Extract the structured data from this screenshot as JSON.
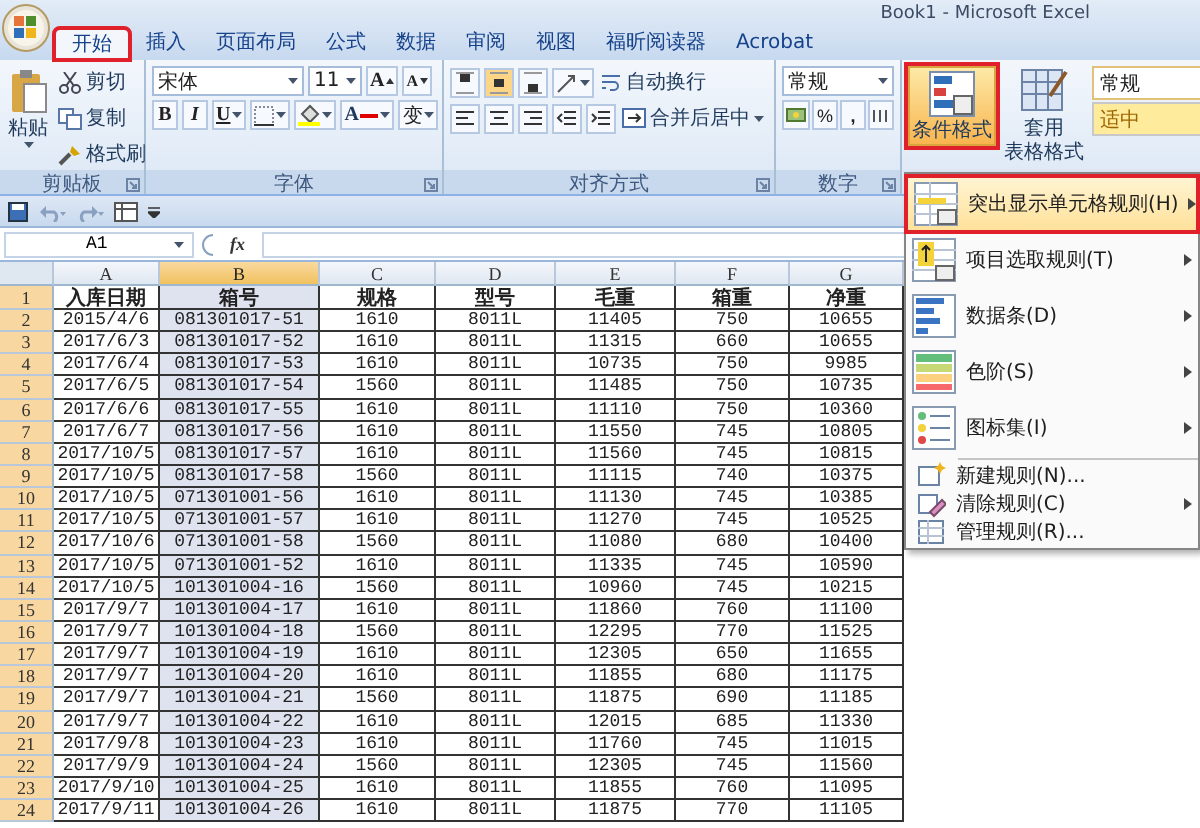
{
  "window": {
    "title": "Book1 - Microsoft Excel"
  },
  "tabs": [
    {
      "label": "开始",
      "selected": true,
      "highlighted": true
    },
    {
      "label": "插入",
      "selected": false,
      "highlighted": false
    },
    {
      "label": "页面布局",
      "selected": false,
      "highlighted": false
    },
    {
      "label": "公式",
      "selected": false,
      "highlighted": false
    },
    {
      "label": "数据",
      "selected": false,
      "highlighted": false
    },
    {
      "label": "审阅",
      "selected": false,
      "highlighted": false
    },
    {
      "label": "视图",
      "selected": false,
      "highlighted": false
    },
    {
      "label": "福昕阅读器",
      "selected": false,
      "highlighted": false
    },
    {
      "label": "Acrobat",
      "selected": false,
      "highlighted": false
    }
  ],
  "ribbon": {
    "clipboard": {
      "label": "剪贴板",
      "paste": "粘贴",
      "cut": "剪切",
      "copy": "复制",
      "format_painter": "格式刷"
    },
    "font": {
      "label": "字体",
      "name": "宋体",
      "size": "11",
      "grow": "A",
      "shrink": "A",
      "bold": "B",
      "italic": "I",
      "underline": "U",
      "font_color": "A",
      "phonetic": "变"
    },
    "alignment": {
      "label": "对齐方式",
      "wrap_text": "自动换行",
      "merge_center": "合并后居中"
    },
    "number": {
      "label": "数字",
      "format": "常规",
      "percent": "%",
      "comma": ","
    },
    "styles": {
      "conditional_formatting": {
        "label": "条件格式",
        "selected": true,
        "highlighted": true
      },
      "format_as_table": [
        "套用",
        "表格格式"
      ],
      "cell_styles": [
        {
          "label": "常规",
          "kind": "normal"
        },
        {
          "label": "适中",
          "kind": "neutral"
        }
      ]
    }
  },
  "formula_bar": {
    "name_box": "A1",
    "fx": "fx"
  },
  "sheet": {
    "columns": [
      {
        "label": "A",
        "selected": false
      },
      {
        "label": "B",
        "selected": true
      },
      {
        "label": "C",
        "selected": false
      },
      {
        "label": "D",
        "selected": false
      },
      {
        "label": "E",
        "selected": false
      },
      {
        "label": "F",
        "selected": false
      },
      {
        "label": "G",
        "selected": false
      }
    ],
    "rows": [
      {
        "number": "1",
        "kind": "header",
        "cells": [
          "入库日期",
          "箱号",
          "规格",
          "型号",
          "毛重",
          "箱重",
          "净重"
        ]
      },
      {
        "number": "2",
        "kind": "data",
        "cells": [
          "2015/4/6",
          "081301017-51",
          "1610",
          "8011L",
          "11405",
          "750",
          "10655"
        ]
      },
      {
        "number": "3",
        "kind": "data",
        "cells": [
          "2017/6/3",
          "081301017-52",
          "1610",
          "8011L",
          "11315",
          "660",
          "10655"
        ]
      },
      {
        "number": "4",
        "kind": "data",
        "cells": [
          "2017/6/4",
          "081301017-53",
          "1610",
          "8011L",
          "10735",
          "750",
          "9985"
        ]
      },
      {
        "number": "5",
        "kind": "data",
        "cells": [
          "2017/6/5",
          "081301017-54",
          "1560",
          "8011L",
          "11485",
          "750",
          "10735"
        ]
      },
      {
        "number": "6",
        "kind": "data",
        "cells": [
          "2017/6/6",
          "081301017-55",
          "1610",
          "8011L",
          "11110",
          "750",
          "10360"
        ]
      },
      {
        "number": "7",
        "kind": "data",
        "cells": [
          "2017/6/7",
          "081301017-56",
          "1610",
          "8011L",
          "11550",
          "745",
          "10805"
        ]
      },
      {
        "number": "8",
        "kind": "data",
        "cells": [
          "2017/10/5",
          "081301017-57",
          "1610",
          "8011L",
          "11560",
          "745",
          "10815"
        ]
      },
      {
        "number": "9",
        "kind": "data",
        "cells": [
          "2017/10/5",
          "081301017-58",
          "1560",
          "8011L",
          "11115",
          "740",
          "10375"
        ]
      },
      {
        "number": "10",
        "kind": "data",
        "cells": [
          "2017/10/5",
          "071301001-56",
          "1610",
          "8011L",
          "11130",
          "745",
          "10385"
        ]
      },
      {
        "number": "11",
        "kind": "data",
        "cells": [
          "2017/10/5",
          "071301001-57",
          "1610",
          "8011L",
          "11270",
          "745",
          "10525"
        ]
      },
      {
        "number": "12",
        "kind": "data",
        "cells": [
          "2017/10/6",
          "071301001-58",
          "1560",
          "8011L",
          "11080",
          "680",
          "10400"
        ]
      },
      {
        "number": "13",
        "kind": "data",
        "cells": [
          "2017/10/5",
          "071301001-52",
          "1610",
          "8011L",
          "11335",
          "745",
          "10590"
        ]
      },
      {
        "number": "14",
        "kind": "data",
        "cells": [
          "2017/10/5",
          "101301004-16",
          "1560",
          "8011L",
          "10960",
          "745",
          "10215"
        ]
      },
      {
        "number": "15",
        "kind": "data",
        "cells": [
          "2017/9/7",
          "101301004-17",
          "1610",
          "8011L",
          "11860",
          "760",
          "11100"
        ]
      },
      {
        "number": "16",
        "kind": "data",
        "cells": [
          "2017/9/7",
          "101301004-18",
          "1560",
          "8011L",
          "12295",
          "770",
          "11525"
        ]
      },
      {
        "number": "17",
        "kind": "data",
        "cells": [
          "2017/9/7",
          "101301004-19",
          "1610",
          "8011L",
          "12305",
          "650",
          "11655"
        ]
      },
      {
        "number": "18",
        "kind": "data",
        "cells": [
          "2017/9/7",
          "101301004-20",
          "1610",
          "8011L",
          "11855",
          "680",
          "11175"
        ]
      },
      {
        "number": "19",
        "kind": "data",
        "cells": [
          "2017/9/7",
          "101301004-21",
          "1560",
          "8011L",
          "11875",
          "690",
          "11185"
        ]
      },
      {
        "number": "20",
        "kind": "data",
        "cells": [
          "2017/9/7",
          "101301004-22",
          "1610",
          "8011L",
          "12015",
          "685",
          "11330"
        ]
      },
      {
        "number": "21",
        "kind": "data",
        "cells": [
          "2017/9/8",
          "101301004-23",
          "1610",
          "8011L",
          "11760",
          "745",
          "11015"
        ]
      },
      {
        "number": "22",
        "kind": "data",
        "cells": [
          "2017/9/9",
          "101301004-24",
          "1560",
          "8011L",
          "12305",
          "745",
          "11560"
        ]
      },
      {
        "number": "23",
        "kind": "data",
        "cells": [
          "2017/9/10",
          "101301004-25",
          "1610",
          "8011L",
          "11855",
          "760",
          "11095"
        ]
      },
      {
        "number": "24",
        "kind": "data",
        "cells": [
          "2017/9/11",
          "101301004-26",
          "1610",
          "8011L",
          "11875",
          "770",
          "11105"
        ]
      }
    ]
  },
  "menu": {
    "items": [
      {
        "label": "突出显示单元格规则(H)",
        "kind": "highlight",
        "submenu": true,
        "selected": true,
        "highlighted": true
      },
      {
        "label": "项目选取规则(T)",
        "kind": "top",
        "submenu": true,
        "selected": false,
        "highlighted": false
      },
      {
        "label": "数据条(D)",
        "kind": "bars",
        "submenu": true,
        "selected": false,
        "highlighted": false
      },
      {
        "label": "色阶(S)",
        "kind": "scale",
        "submenu": true,
        "selected": false,
        "highlighted": false
      },
      {
        "label": "图标集(I)",
        "kind": "iconset",
        "submenu": true,
        "selected": false,
        "highlighted": false
      },
      {
        "label": "新建规则(N)...",
        "kind": "new",
        "submenu": false,
        "selected": false,
        "highlighted": false
      },
      {
        "label": "清除规则(C)",
        "kind": "clear",
        "submenu": true,
        "selected": false,
        "highlighted": false
      },
      {
        "label": "管理规则(R)...",
        "kind": "manage",
        "submenu": false,
        "selected": false,
        "highlighted": false
      }
    ]
  }
}
